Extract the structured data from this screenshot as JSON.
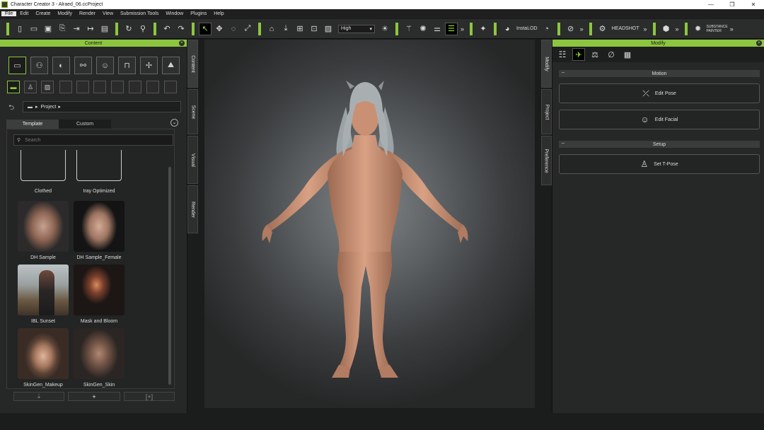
{
  "titlebar": {
    "title": "Character Creator 3 - Alraed_06.ccProject",
    "minimize": "—",
    "maximize": "❐",
    "close": "✕"
  },
  "menu": [
    "File",
    "Edit",
    "Create",
    "Modify",
    "Render",
    "View",
    "Submission Tools",
    "Window",
    "Plugins",
    "Help"
  ],
  "toolbar": {
    "quality_select": "High",
    "instalod_label": "InstaLOD",
    "headshot_label": "HEADSHOT",
    "substance_label_1": "SUBSTANCE",
    "substance_label_2": "PAINTER",
    "more": "»"
  },
  "content_panel": {
    "title": "Content",
    "path_root": "Project",
    "tabs": [
      "Template",
      "Custom"
    ],
    "search_placeholder": "Search",
    "items": [
      "Clothed",
      "Iray Optimized",
      "DH Sample",
      "DH Sample_Female",
      "IBL Sunset",
      "Mask and Bloom",
      "SkinGen_Makeup",
      "SkinGen_Skin"
    ],
    "bottom_add": "+"
  },
  "left_vtabs": [
    "Content",
    "Scene",
    "Visual",
    "Render"
  ],
  "right_vtabs": [
    "Modify",
    "Project",
    "Preference"
  ],
  "modify_panel": {
    "title": "Modify",
    "sections": [
      {
        "title": "Motion",
        "buttons": [
          "Edit Pose",
          "Edit Facial"
        ]
      },
      {
        "title": "Setup",
        "buttons": [
          "Set T-Pose"
        ]
      }
    ]
  }
}
